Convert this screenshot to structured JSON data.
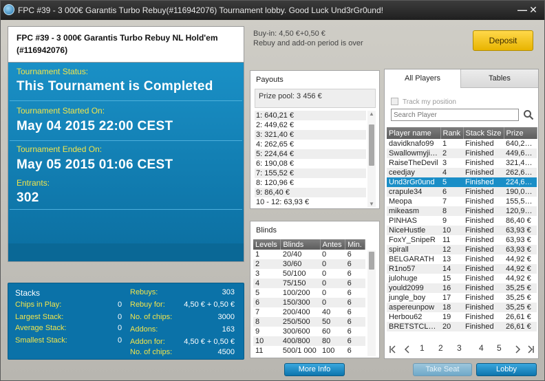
{
  "window": {
    "title": "FPC #39 - 3 000€ Garantis Turbo Rebuy(#116942076) Tournament lobby. Good Luck Und3rGr0und!",
    "minimize_glyph": "—",
    "close_glyph": "✕"
  },
  "header": {
    "buyin": "Buy-in: 4,50 €+0,50 €",
    "rebuy_status": "Rebuy and add-on period is over",
    "deposit_label": "Deposit"
  },
  "tournament": {
    "name_line1": "FPC #39 - 3 000€ Garantis Turbo Rebuy NL Hold'em",
    "name_line2": "(#116942076)",
    "status_label": "Tournament Status:",
    "status_value": "This Tournament is Completed",
    "started_label": "Tournament Started On:",
    "started_value": "May 04 2015  22:00 CEST",
    "ended_label": "Tournament Ended On:",
    "ended_value": "May 05 2015  01:06 CEST",
    "entrants_label": "Entrants:",
    "entrants_value": "302"
  },
  "stacks": {
    "title": "Stacks",
    "chips_in_play_label": "Chips in Play:",
    "chips_in_play": "0",
    "largest_label": "Largest Stack:",
    "largest": "0",
    "average_label": "Average Stack:",
    "average": "0",
    "smallest_label": "Smallest Stack:",
    "smallest": "0",
    "rebuys_label": "Rebuys:",
    "rebuys": "303",
    "rebuy_for_label": "Rebuy for:",
    "rebuy_for": "4,50 € + 0,50 €",
    "no_chips_label": "No. of chips:",
    "no_chips": "3000",
    "addons_label": "Addons:",
    "addons": "163",
    "addon_for_label": "Addon for:",
    "addon_for": "4,50 € + 0,50 €",
    "no_chips2_label": "No. of chips:",
    "no_chips2": "4500"
  },
  "payouts": {
    "title": "Payouts",
    "prize_pool": "Prize pool: 3 456 €",
    "rows": [
      "1: 640,21 €",
      "2: 449,62 €",
      "3: 321,40 €",
      "4: 262,65 €",
      "5: 224,64 €",
      "6: 190,08 €",
      "7: 155,52 €",
      "8: 120,96 €",
      "9: 86,40 €",
      "10 - 12: 63,93 €"
    ]
  },
  "blinds": {
    "title": "Blinds",
    "headers": [
      "Levels",
      "Blinds",
      "Antes",
      "Min."
    ],
    "rows": [
      [
        "1",
        "20/40",
        "0",
        "6"
      ],
      [
        "2",
        "30/60",
        "0",
        "6"
      ],
      [
        "3",
        "50/100",
        "0",
        "6"
      ],
      [
        "4",
        "75/150",
        "0",
        "6"
      ],
      [
        "5",
        "100/200",
        "0",
        "6"
      ],
      [
        "6",
        "150/300",
        "0",
        "6"
      ],
      [
        "7",
        "200/400",
        "40",
        "6"
      ],
      [
        "8",
        "250/500",
        "50",
        "6"
      ],
      [
        "9",
        "300/600",
        "60",
        "6"
      ],
      [
        "10",
        "400/800",
        "80",
        "6"
      ],
      [
        "11",
        "500/1 000",
        "100",
        "6"
      ]
    ]
  },
  "players": {
    "tab_all": "All Players",
    "tab_tables": "Tables",
    "track_label": "Track my position",
    "search_placeholder": "Search Player",
    "headers": [
      "Player name",
      "Rank",
      "Stack Size",
      "Prize"
    ],
    "selected_index": 4,
    "rows": [
      [
        "davidknafo99",
        "1",
        "Finished",
        "640,21 €"
      ],
      [
        "Swallowmyjiz...",
        "2",
        "Finished",
        "449,62 €"
      ],
      [
        "RaiseTheDevil",
        "3",
        "Finished",
        "321,40 €"
      ],
      [
        "ceedjay",
        "4",
        "Finished",
        "262,65 €"
      ],
      [
        "Und3rGr0und",
        "5",
        "Finished",
        "224,64 €"
      ],
      [
        "crapule34",
        "6",
        "Finished",
        "190,08 €"
      ],
      [
        "Meopa",
        "7",
        "Finished",
        "155,52 €"
      ],
      [
        "mikeasm",
        "8",
        "Finished",
        "120,96 €"
      ],
      [
        "PINHAS",
        "9",
        "Finished",
        "86,40 €"
      ],
      [
        "NiceHustle",
        "10",
        "Finished",
        "63,93 €"
      ],
      [
        "FoxY_SnipeR",
        "11",
        "Finished",
        "63,93 €"
      ],
      [
        "spirall",
        "12",
        "Finished",
        "63,93 €"
      ],
      [
        "BELGARATH",
        "13",
        "Finished",
        "44,92 €"
      ],
      [
        "R1no57",
        "14",
        "Finished",
        "44,92 €"
      ],
      [
        "julohuge",
        "15",
        "Finished",
        "44,92 €"
      ],
      [
        "yould2099",
        "16",
        "Finished",
        "35,25 €"
      ],
      [
        "jungle_boy",
        "17",
        "Finished",
        "35,25 €"
      ],
      [
        "aspereunpow",
        "18",
        "Finished",
        "35,25 €"
      ],
      [
        "Herbou62",
        "19",
        "Finished",
        "26,61 €"
      ],
      [
        "BRETSTCLER",
        "20",
        "Finished",
        "26,61 €"
      ]
    ],
    "pages": [
      "1",
      "2",
      "3",
      "4",
      "5"
    ]
  },
  "footer": {
    "more_info": "More Info",
    "take_seat": "Take Seat",
    "lobby": "Lobby"
  },
  "colors": {
    "accent_blue": "#1a8ec7",
    "label_yellow": "#f2e54b",
    "deposit_gold": "#f2c11f"
  }
}
